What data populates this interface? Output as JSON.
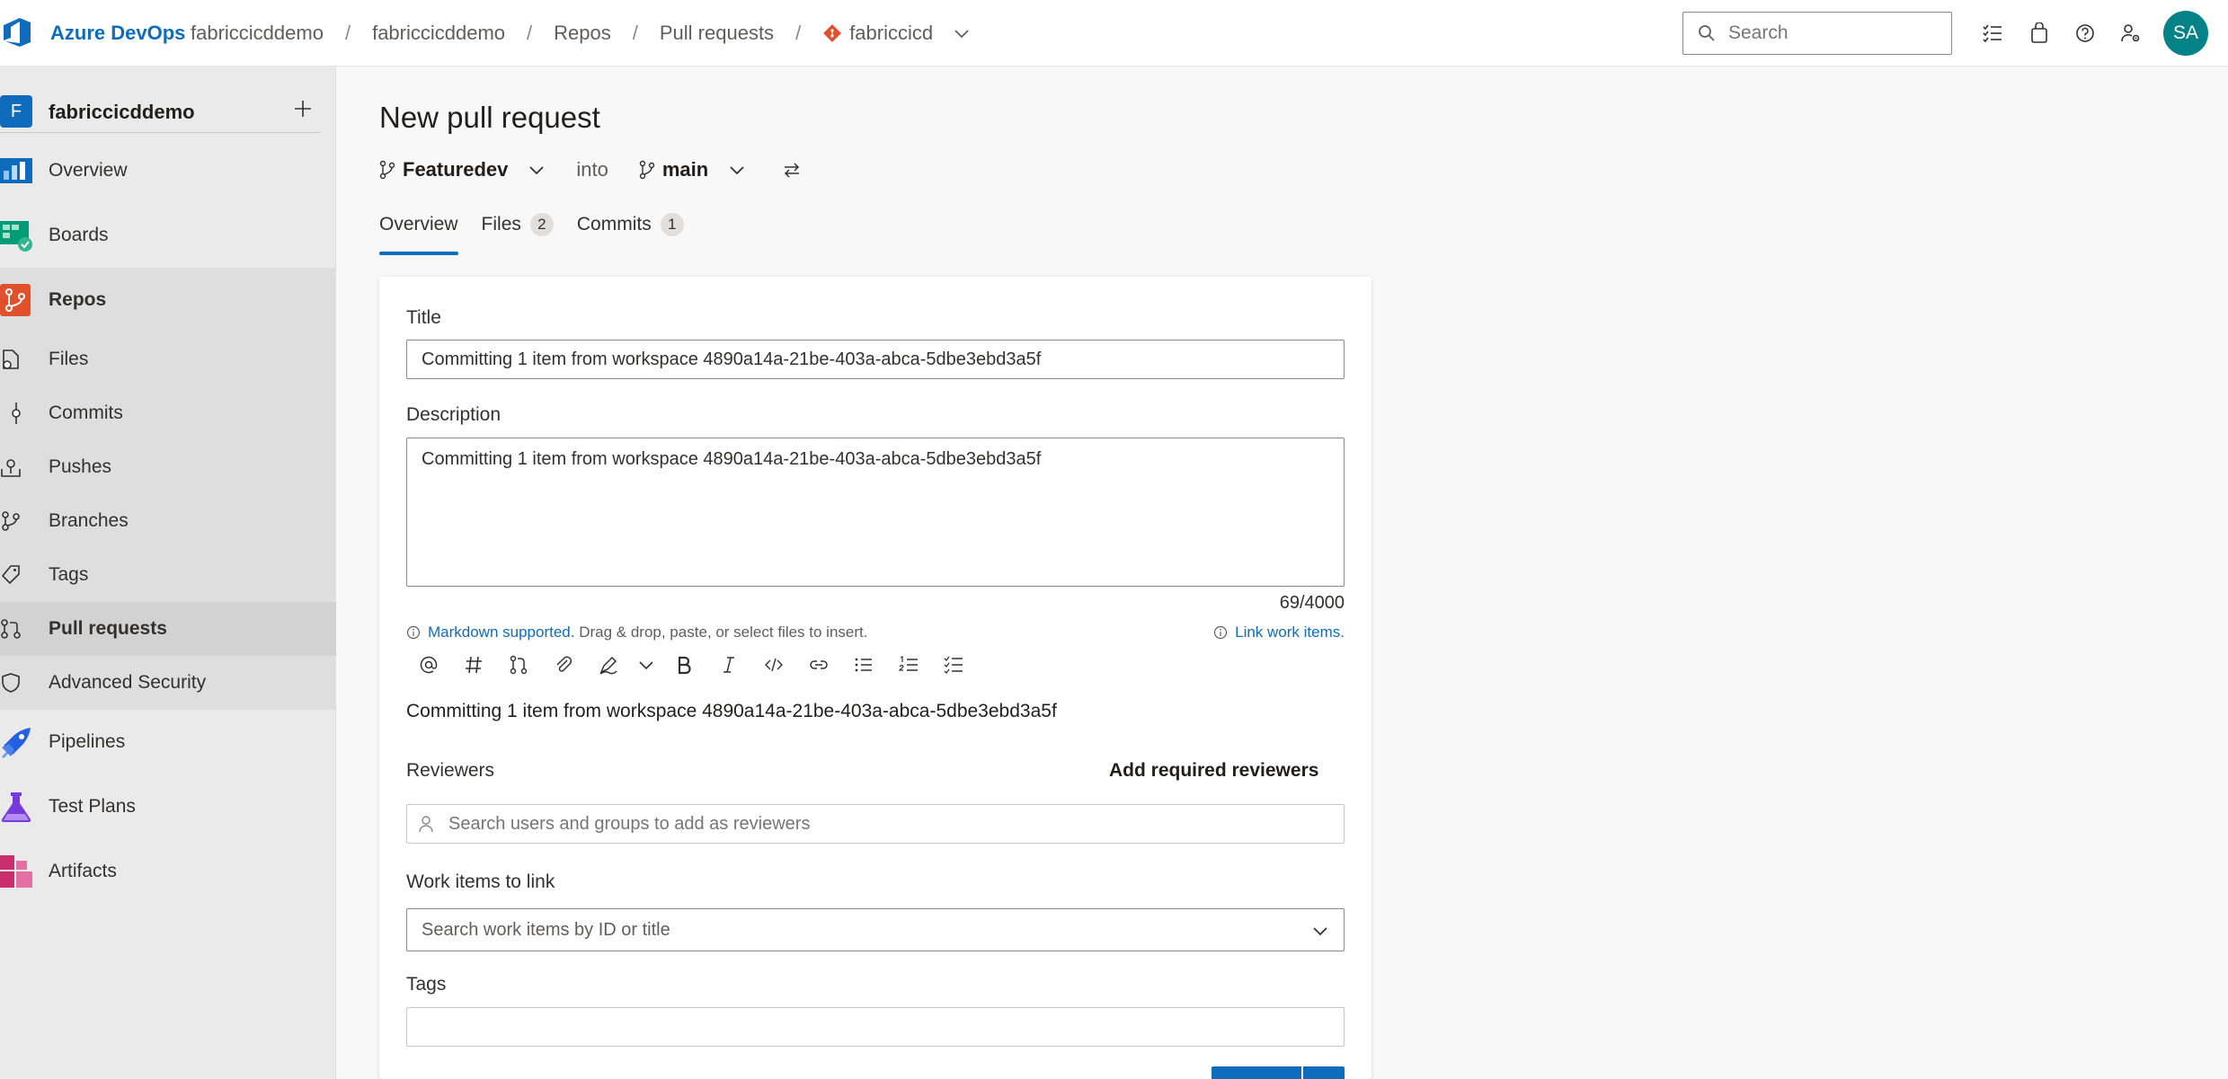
{
  "header": {
    "brand": "Azure DevOps",
    "breadcrumbs": [
      "fabriccicddemo",
      "fabriccicddemo",
      "Repos",
      "Pull requests"
    ],
    "repo": "fabriccicd",
    "search_placeholder": "Search",
    "avatar_initials": "SA"
  },
  "sidebar": {
    "project_initial": "F",
    "project_name": "fabriccicddemo",
    "items": [
      {
        "label": "Overview"
      },
      {
        "label": "Boards"
      },
      {
        "label": "Repos"
      },
      {
        "label": "Files"
      },
      {
        "label": "Commits"
      },
      {
        "label": "Pushes"
      },
      {
        "label": "Branches"
      },
      {
        "label": "Tags"
      },
      {
        "label": "Pull requests"
      },
      {
        "label": "Advanced Security"
      },
      {
        "label": "Pipelines"
      },
      {
        "label": "Test Plans"
      },
      {
        "label": "Artifacts"
      }
    ]
  },
  "main": {
    "title": "New pull request",
    "source_branch": "Featuredev",
    "into_label": "into",
    "target_branch": "main",
    "tabs": [
      {
        "label": "Overview",
        "count": null
      },
      {
        "label": "Files",
        "count": "2"
      },
      {
        "label": "Commits",
        "count": "1"
      }
    ]
  },
  "form": {
    "title_label": "Title",
    "title_value": "Committing 1 item from workspace 4890a14a-21be-403a-abca-5dbe3ebd3a5f",
    "description_label": "Description",
    "description_value": "Committing 1 item from workspace 4890a14a-21be-403a-abca-5dbe3ebd3a5f",
    "char_count": "69/4000",
    "markdown_link": "Markdown supported.",
    "markdown_hint": " Drag & drop, paste, or select files to insert.",
    "link_work_items": "Link work items.",
    "preview": "Committing 1 item from workspace 4890a14a-21be-403a-abca-5dbe3ebd3a5f",
    "reviewers_label": "Reviewers",
    "add_required_reviewers": "Add required reviewers",
    "reviewers_placeholder": "Search users and groups to add as reviewers",
    "work_items_label": "Work items to link",
    "work_items_placeholder": "Search work items by ID or title",
    "tags_label": "Tags"
  },
  "colors": {
    "accent": "#0f6cbd",
    "avatar": "#038387",
    "repos_icon": "#e0502b"
  }
}
